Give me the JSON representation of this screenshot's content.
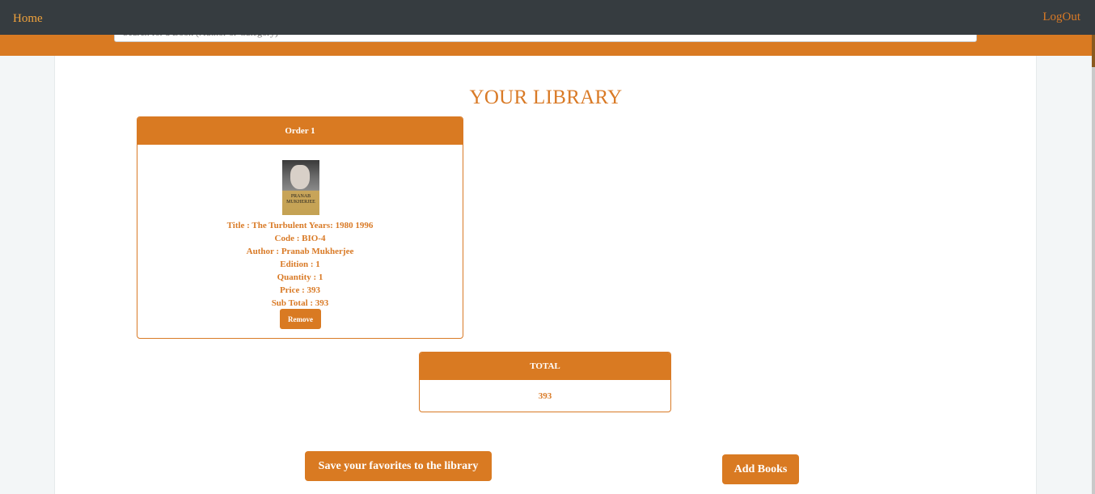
{
  "nav": {
    "home_label": "Home",
    "logout_label": "LogOut"
  },
  "search": {
    "placeholder": "Search for a Book (Author or Category)"
  },
  "page_title": "YOUR LIBRARY",
  "order": {
    "header": "Order 1",
    "cover_text": "PRANAB MUKHERJEE",
    "details": [
      "Title : The Turbulent Years: 1980 1996",
      "Code : BIO-4",
      "Author : Pranab Mukherjee",
      "Edition : 1",
      "Quantity : 1",
      "Price : 393",
      "Sub Total : 393"
    ],
    "remove_label": "Remove"
  },
  "total": {
    "header": "TOTAL",
    "value": "393"
  },
  "buttons": {
    "save_label": "Save your favorites to the library",
    "add_label": "Add Books"
  },
  "colors": {
    "accent": "#d97a22",
    "navbar": "#363c40",
    "background": "#f3f6f7"
  }
}
